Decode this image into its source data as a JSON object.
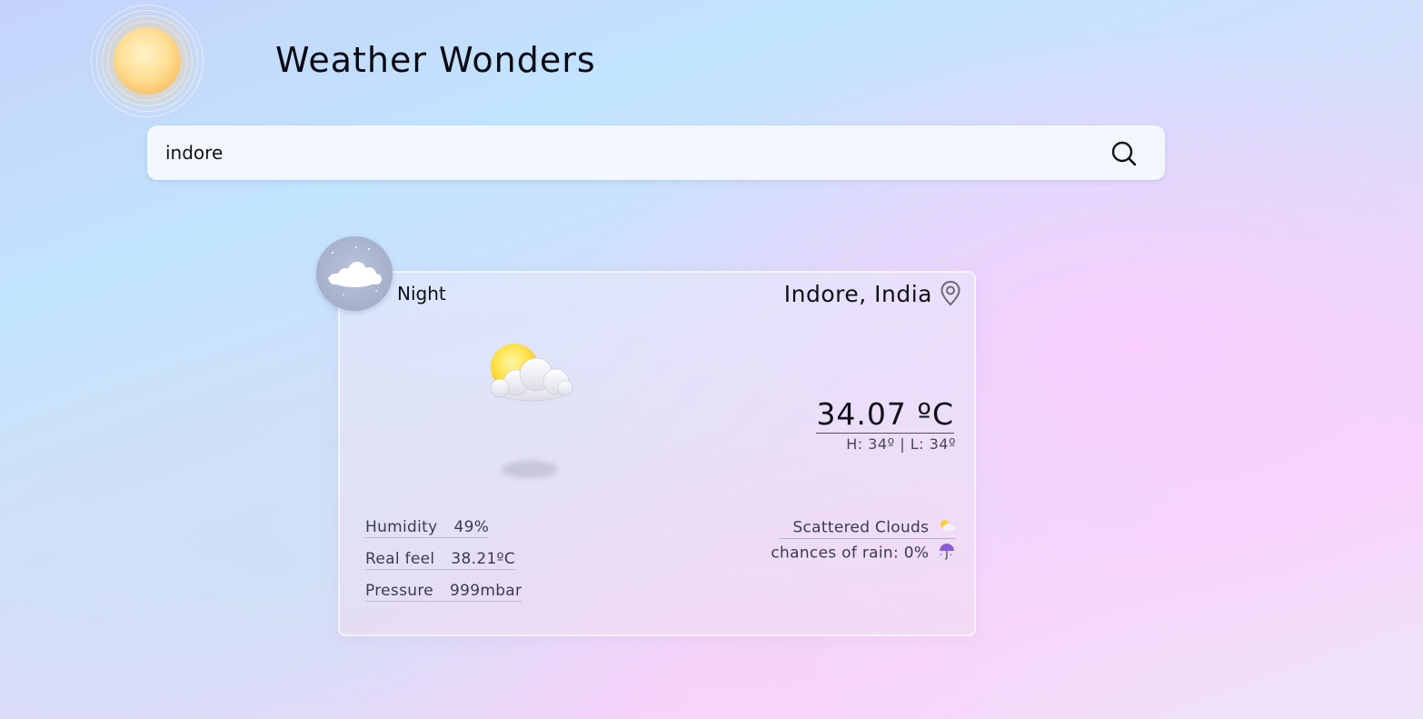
{
  "header": {
    "title": "Weather Wonders",
    "logo_icon": "sun-icon"
  },
  "search": {
    "value": "indore",
    "placeholder": "",
    "button_icon": "search-icon"
  },
  "card": {
    "period": "Night",
    "period_icon": "moon-cloud-icon",
    "location": "Indore, India",
    "location_icon": "map-pin-icon",
    "condition_icon": "sun-behind-cloud-icon",
    "temperature": "34.07 ºC",
    "high_low": "H: 34º  |  L: 34º",
    "stats": [
      {
        "label": "Humidity",
        "value": "49%"
      },
      {
        "label": "Real feel",
        "value": "38.21ºC"
      },
      {
        "label": "Pressure",
        "value": "999mbar"
      }
    ],
    "condition": "Scattered Clouds",
    "rain": "chances of rain: 0%",
    "rain_icon": "umbrella-icon"
  },
  "colors": {
    "sun_core": "#ffdf95",
    "sun_edge": "#f3a94a",
    "badge_bg": "#a4b0cb",
    "text_primary": "#101018",
    "text_secondary": "#3b3b4e"
  }
}
